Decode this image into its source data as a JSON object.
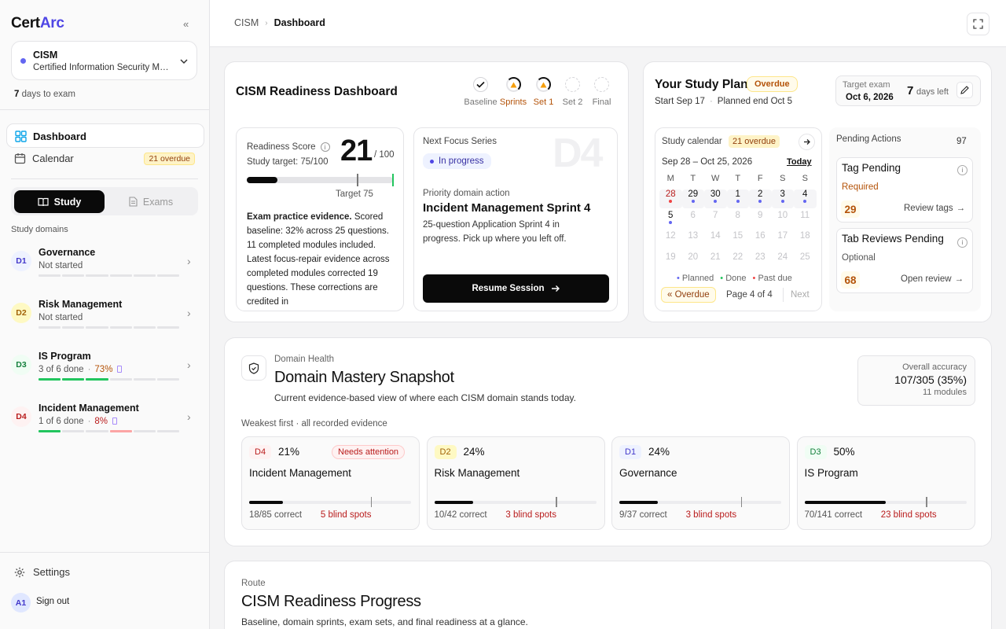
{
  "app": {
    "brand_a": "Cert",
    "brand_b": "Arc"
  },
  "cert": {
    "name": "CISM",
    "full": "Certified Information Security Manager",
    "days_num": "7",
    "days_text": "days to exam"
  },
  "nav": {
    "dashboard": "Dashboard",
    "calendar": "Calendar",
    "calendar_badge": "21 overdue",
    "study": "Study",
    "exams": "Exams",
    "study_domains": "Study domains",
    "settings": "Settings",
    "avatar": "A1",
    "sign_out": "Sign out"
  },
  "domains": [
    {
      "code": "D1",
      "name": "Governance",
      "status": "Not started",
      "pct": "",
      "done_segments": 0,
      "color": "#4338ca",
      "bg": "#eef2ff",
      "bar": "#e4e4e7"
    },
    {
      "code": "D2",
      "name": "Risk Management",
      "status": "Not started",
      "pct": "",
      "done_segments": 0,
      "color": "#a16207",
      "bg": "#fef9c3",
      "bar": "#e4e4e7"
    },
    {
      "code": "D3",
      "name": "IS Program",
      "status": "3 of 6 done",
      "pct": "73%",
      "done_segments": 3,
      "color": "#15803d",
      "bg": "#f0fdf4",
      "bar": "#22c55e"
    },
    {
      "code": "D4",
      "name": "Incident Management",
      "status": "1 of 6 done",
      "pct": "8%",
      "done_segments": 1,
      "color": "#b91c1c",
      "bg": "#fef2f2",
      "bar": "#22c55e"
    }
  ],
  "breadcrumb": {
    "root": "CISM",
    "current": "Dashboard"
  },
  "readiness": {
    "title": "CISM Readiness Dashboard",
    "steps": [
      {
        "label": "Baseline",
        "state": "done"
      },
      {
        "label": "Sprints",
        "state": "warn"
      },
      {
        "label": "Set 1",
        "state": "warn"
      },
      {
        "label": "Set 2",
        "state": "todo"
      },
      {
        "label": "Final",
        "state": "todo"
      }
    ],
    "score_label": "Readiness Score",
    "score": "21",
    "score_max": "/ 100",
    "study_target": "Study target: 75/100",
    "score_fraction": 0.21,
    "target_fraction": 0.75,
    "target_label": "Target 75",
    "evidence_head": "Exam practice evidence.",
    "evidence_body": "Scored baseline: 32% across 25 questions. 11 completed modules included. Latest focus-repair evidence across completed modules corrected 19 questions. These corrections are credited in",
    "next_focus": "Next Focus Series",
    "watermark": "D4",
    "in_progress": "In progress",
    "priority_label": "Priority domain action",
    "priority_title": "Incident Management Sprint 4",
    "priority_desc": "25-question Application Sprint 4 in progress. Pick up where you left off.",
    "resume": "Resume Session"
  },
  "plan": {
    "title": "Your Study Plan",
    "overdue_badge": "Overdue",
    "start": "Start Sep 17",
    "dot": "·",
    "end": "Planned end Oct 5",
    "target_label": "Target exam",
    "target_date": "Oct 6, 2026",
    "days_num": "7",
    "days_text": "days left",
    "cal_title": "Study calendar",
    "cal_overdue": "21 overdue",
    "range": "Sep 28 – Oct 25, 2026",
    "today": "Today",
    "weekdays": [
      "M",
      "T",
      "W",
      "T",
      "F",
      "S",
      "S"
    ],
    "weeks": [
      [
        "28",
        "29",
        "30",
        "1",
        "2",
        "3",
        "4"
      ],
      [
        "5",
        "6",
        "7",
        "8",
        "9",
        "10",
        "11"
      ],
      [
        "12",
        "13",
        "14",
        "15",
        "16",
        "17",
        "18"
      ],
      [
        "19",
        "20",
        "21",
        "22",
        "23",
        "24",
        "25"
      ]
    ],
    "legend_planned": "Planned",
    "legend_done": "Done",
    "legend_past": "Past due",
    "prev": "« Overdue",
    "page": "Page 4 of 4",
    "next": "Next",
    "pending_title": "Pending Actions",
    "pending_count": "97",
    "tag_title": "Tag Pending",
    "tag_req": "Required",
    "tag_count": "29",
    "tag_action": "Review tags",
    "tab_title": "Tab Reviews Pending",
    "tab_opt": "Optional",
    "tab_count": "68",
    "tab_action": "Open review"
  },
  "health": {
    "eyebrow": "Domain Health",
    "title": "Domain Mastery Snapshot",
    "desc": "Current evidence-based view of where each CISM domain stands today.",
    "acc_label": "Overall accuracy",
    "acc_value": "107/305 (35%)",
    "acc_modules": "11 modules",
    "order": "Weakest first · all recorded evidence",
    "cards": [
      {
        "code": "D4",
        "pct": "21%",
        "name": "Incident Management",
        "tag": "Needs attention",
        "fraction": 0.21,
        "correct": "18/85 correct",
        "blind": "5 blind spots",
        "color": "#b91c1c",
        "bg": "#fef2f2"
      },
      {
        "code": "D2",
        "pct": "24%",
        "name": "Risk Management",
        "tag": "",
        "fraction": 0.24,
        "correct": "10/42 correct",
        "blind": "3 blind spots",
        "color": "#a16207",
        "bg": "#fef9c3"
      },
      {
        "code": "D1",
        "pct": "24%",
        "name": "Governance",
        "tag": "",
        "fraction": 0.24,
        "correct": "9/37 correct",
        "blind": "3 blind spots",
        "color": "#4338ca",
        "bg": "#eef2ff"
      },
      {
        "code": "D3",
        "pct": "50%",
        "name": "IS Program",
        "tag": "",
        "fraction": 0.5,
        "correct": "70/141 correct",
        "blind": "23 blind spots",
        "color": "#15803d",
        "bg": "#f0fdf4"
      }
    ]
  },
  "route": {
    "eyebrow": "Route",
    "title": "CISM Readiness Progress",
    "desc": "Baseline, domain sprints, exam sets, and final readiness at a glance."
  }
}
